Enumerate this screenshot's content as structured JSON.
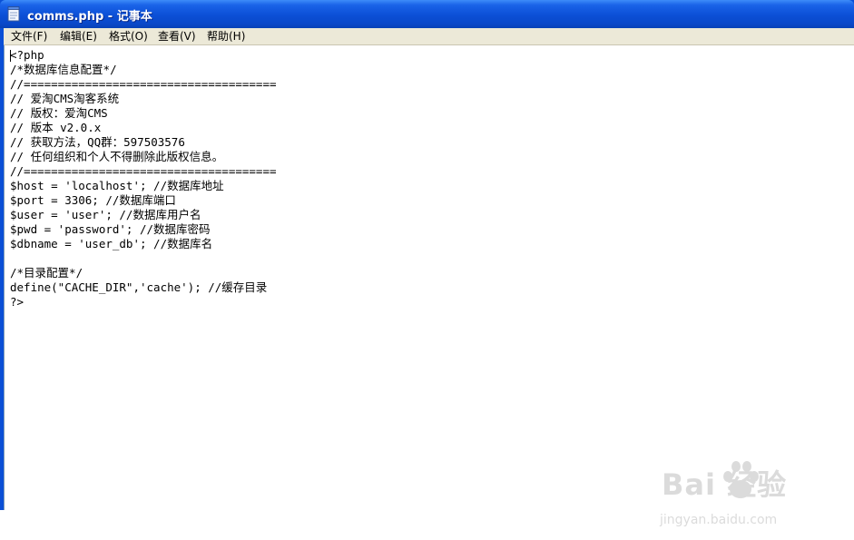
{
  "window": {
    "title": "comms.php - 记事本",
    "icon": "notepad-icon"
  },
  "menubar": {
    "items": [
      {
        "label": "文件(F)"
      },
      {
        "label": "编辑(E)"
      },
      {
        "label": "格式(O)"
      },
      {
        "label": "查看(V)"
      },
      {
        "label": "帮助(H)"
      }
    ]
  },
  "editor": {
    "lines": [
      "<?php",
      "/*数据库信息配置*/",
      "//=====================================",
      "// 爱淘CMS淘客系统",
      "// 版权：爱淘CMS",
      "// 版本 v2.0.x",
      "// 获取方法，QQ群：597503576",
      "// 任何组织和个人不得删除此版权信息。",
      "//=====================================",
      "$host = 'localhost'; //数据库地址",
      "$port = 3306; //数据库端口",
      "$user = 'user'; //数据库用户名",
      "$pwd = 'password'; //数据库密码",
      "$dbname = 'user_db'; //数据库名",
      "",
      "/*目录配置*/",
      "define(\"CACHE_DIR\",'cache'); //缓存目录",
      "?>"
    ]
  },
  "watermark": {
    "logo_text": "Bai 经验",
    "url_text": "jingyan.baidu.com"
  }
}
